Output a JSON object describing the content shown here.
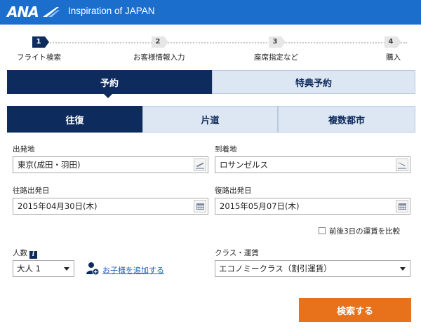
{
  "header": {
    "logo_text": "ANA",
    "tagline": "Inspiration of JAPAN",
    "bg_color": "#1c6ecd"
  },
  "steps": [
    {
      "number": "1",
      "label": "フライト検索",
      "active": true
    },
    {
      "number": "2",
      "label": "お客様情報入力",
      "active": false
    },
    {
      "number": "3",
      "label": "座席指定など",
      "active": false
    },
    {
      "number": "4",
      "label": "購入",
      "active": false
    }
  ],
  "booking_tabs": {
    "reservation": "予約",
    "award": "特典予約",
    "selected": "予約"
  },
  "trip_tabs": {
    "round_trip": "往復",
    "one_way": "片道",
    "multi_city": "複数都市",
    "selected": "往復"
  },
  "form": {
    "origin_label": "出発地",
    "origin_value": "東京(成田・羽田)",
    "destination_label": "到着地",
    "destination_value": "ロサンゼルス",
    "depart_label": "往路出発日",
    "depart_value": "2015年04月30日(木)",
    "return_label": "復路出発日",
    "return_value": "2015年05月07日(木)",
    "compare_label": "前後3日の運賃を比較",
    "compare_checked": false,
    "passengers_label": "人数",
    "passengers_value": "大人 1",
    "add_child_link": "お子様を追加する",
    "class_label": "クラス・運賃",
    "class_value": "エコノミークラス（割引運賃）"
  },
  "search_button": "検索する",
  "colors": {
    "navy": "#0d2b5c",
    "light_tab": "#dde6f3",
    "orange": "#e8711b"
  }
}
